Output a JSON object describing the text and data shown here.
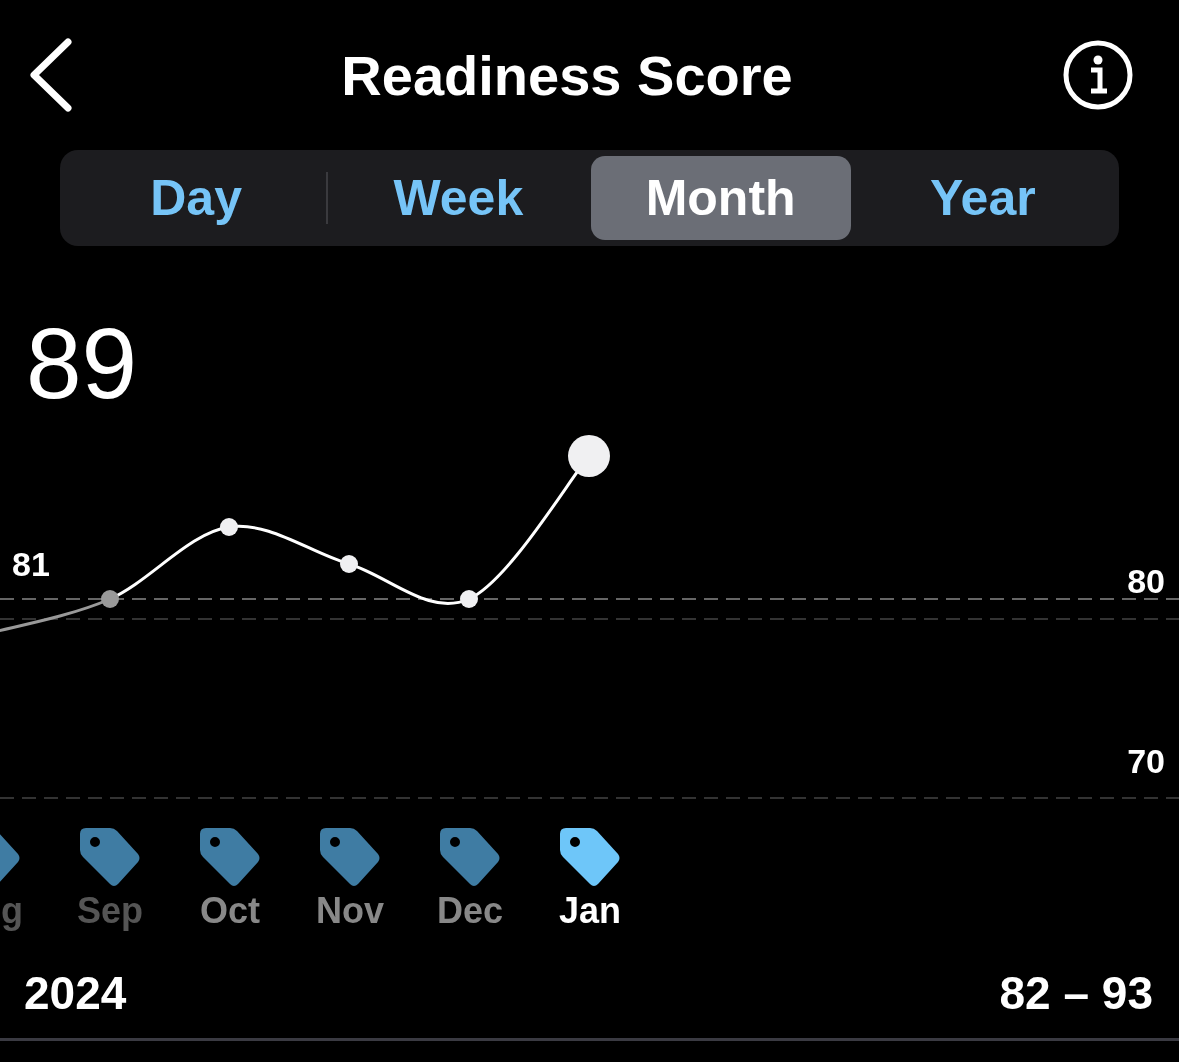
{
  "header": {
    "title": "Readiness Score"
  },
  "tabs": [
    {
      "label": "Day",
      "selected": false
    },
    {
      "label": "Week",
      "selected": false
    },
    {
      "label": "Month",
      "selected": true
    },
    {
      "label": "Year",
      "selected": false
    }
  ],
  "score": "89",
  "chart": {
    "average_label": "81",
    "y_labels": [
      "80",
      "70"
    ],
    "months": [
      {
        "label": "g",
        "selected": false,
        "faded": true
      },
      {
        "label": "Sep",
        "selected": false,
        "faded": true
      },
      {
        "label": "Oct",
        "selected": false,
        "faded": false
      },
      {
        "label": "Nov",
        "selected": false,
        "faded": false
      },
      {
        "label": "Dec",
        "selected": false,
        "faded": false
      },
      {
        "label": "Jan",
        "selected": true,
        "faded": false
      }
    ]
  },
  "footer": {
    "year": "2024",
    "range": "82 – 93"
  }
}
